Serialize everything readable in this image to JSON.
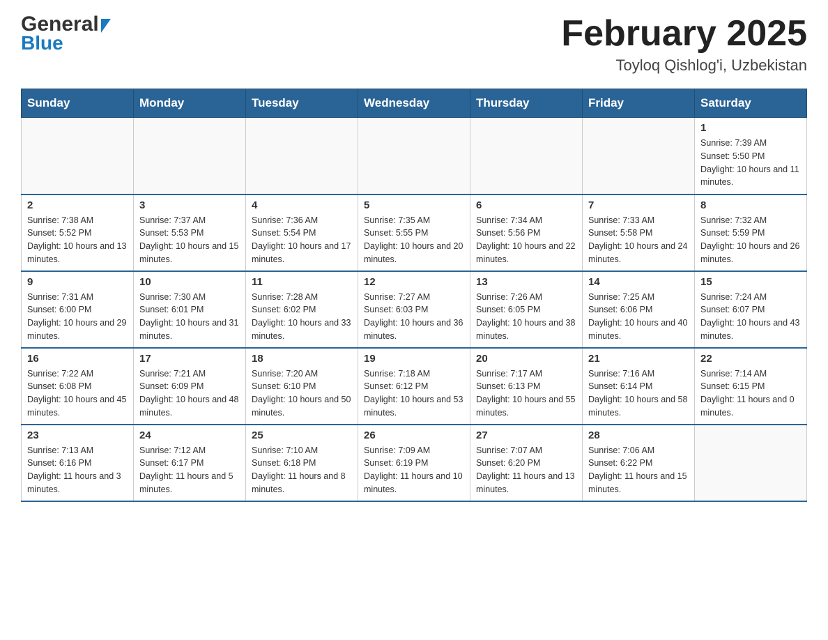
{
  "header": {
    "logo_general": "General",
    "logo_blue": "Blue",
    "title": "February 2025",
    "subtitle": "Toyloq Qishlog'i, Uzbekistan"
  },
  "days_of_week": [
    "Sunday",
    "Monday",
    "Tuesday",
    "Wednesday",
    "Thursday",
    "Friday",
    "Saturday"
  ],
  "weeks": [
    {
      "days": [
        {
          "date": "",
          "info": ""
        },
        {
          "date": "",
          "info": ""
        },
        {
          "date": "",
          "info": ""
        },
        {
          "date": "",
          "info": ""
        },
        {
          "date": "",
          "info": ""
        },
        {
          "date": "",
          "info": ""
        },
        {
          "date": "1",
          "info": "Sunrise: 7:39 AM\nSunset: 5:50 PM\nDaylight: 10 hours and 11 minutes."
        }
      ]
    },
    {
      "days": [
        {
          "date": "2",
          "info": "Sunrise: 7:38 AM\nSunset: 5:52 PM\nDaylight: 10 hours and 13 minutes."
        },
        {
          "date": "3",
          "info": "Sunrise: 7:37 AM\nSunset: 5:53 PM\nDaylight: 10 hours and 15 minutes."
        },
        {
          "date": "4",
          "info": "Sunrise: 7:36 AM\nSunset: 5:54 PM\nDaylight: 10 hours and 17 minutes."
        },
        {
          "date": "5",
          "info": "Sunrise: 7:35 AM\nSunset: 5:55 PM\nDaylight: 10 hours and 20 minutes."
        },
        {
          "date": "6",
          "info": "Sunrise: 7:34 AM\nSunset: 5:56 PM\nDaylight: 10 hours and 22 minutes."
        },
        {
          "date": "7",
          "info": "Sunrise: 7:33 AM\nSunset: 5:58 PM\nDaylight: 10 hours and 24 minutes."
        },
        {
          "date": "8",
          "info": "Sunrise: 7:32 AM\nSunset: 5:59 PM\nDaylight: 10 hours and 26 minutes."
        }
      ]
    },
    {
      "days": [
        {
          "date": "9",
          "info": "Sunrise: 7:31 AM\nSunset: 6:00 PM\nDaylight: 10 hours and 29 minutes."
        },
        {
          "date": "10",
          "info": "Sunrise: 7:30 AM\nSunset: 6:01 PM\nDaylight: 10 hours and 31 minutes."
        },
        {
          "date": "11",
          "info": "Sunrise: 7:28 AM\nSunset: 6:02 PM\nDaylight: 10 hours and 33 minutes."
        },
        {
          "date": "12",
          "info": "Sunrise: 7:27 AM\nSunset: 6:03 PM\nDaylight: 10 hours and 36 minutes."
        },
        {
          "date": "13",
          "info": "Sunrise: 7:26 AM\nSunset: 6:05 PM\nDaylight: 10 hours and 38 minutes."
        },
        {
          "date": "14",
          "info": "Sunrise: 7:25 AM\nSunset: 6:06 PM\nDaylight: 10 hours and 40 minutes."
        },
        {
          "date": "15",
          "info": "Sunrise: 7:24 AM\nSunset: 6:07 PM\nDaylight: 10 hours and 43 minutes."
        }
      ]
    },
    {
      "days": [
        {
          "date": "16",
          "info": "Sunrise: 7:22 AM\nSunset: 6:08 PM\nDaylight: 10 hours and 45 minutes."
        },
        {
          "date": "17",
          "info": "Sunrise: 7:21 AM\nSunset: 6:09 PM\nDaylight: 10 hours and 48 minutes."
        },
        {
          "date": "18",
          "info": "Sunrise: 7:20 AM\nSunset: 6:10 PM\nDaylight: 10 hours and 50 minutes."
        },
        {
          "date": "19",
          "info": "Sunrise: 7:18 AM\nSunset: 6:12 PM\nDaylight: 10 hours and 53 minutes."
        },
        {
          "date": "20",
          "info": "Sunrise: 7:17 AM\nSunset: 6:13 PM\nDaylight: 10 hours and 55 minutes."
        },
        {
          "date": "21",
          "info": "Sunrise: 7:16 AM\nSunset: 6:14 PM\nDaylight: 10 hours and 58 minutes."
        },
        {
          "date": "22",
          "info": "Sunrise: 7:14 AM\nSunset: 6:15 PM\nDaylight: 11 hours and 0 minutes."
        }
      ]
    },
    {
      "days": [
        {
          "date": "23",
          "info": "Sunrise: 7:13 AM\nSunset: 6:16 PM\nDaylight: 11 hours and 3 minutes."
        },
        {
          "date": "24",
          "info": "Sunrise: 7:12 AM\nSunset: 6:17 PM\nDaylight: 11 hours and 5 minutes."
        },
        {
          "date": "25",
          "info": "Sunrise: 7:10 AM\nSunset: 6:18 PM\nDaylight: 11 hours and 8 minutes."
        },
        {
          "date": "26",
          "info": "Sunrise: 7:09 AM\nSunset: 6:19 PM\nDaylight: 11 hours and 10 minutes."
        },
        {
          "date": "27",
          "info": "Sunrise: 7:07 AM\nSunset: 6:20 PM\nDaylight: 11 hours and 13 minutes."
        },
        {
          "date": "28",
          "info": "Sunrise: 7:06 AM\nSunset: 6:22 PM\nDaylight: 11 hours and 15 minutes."
        },
        {
          "date": "",
          "info": ""
        }
      ]
    }
  ]
}
